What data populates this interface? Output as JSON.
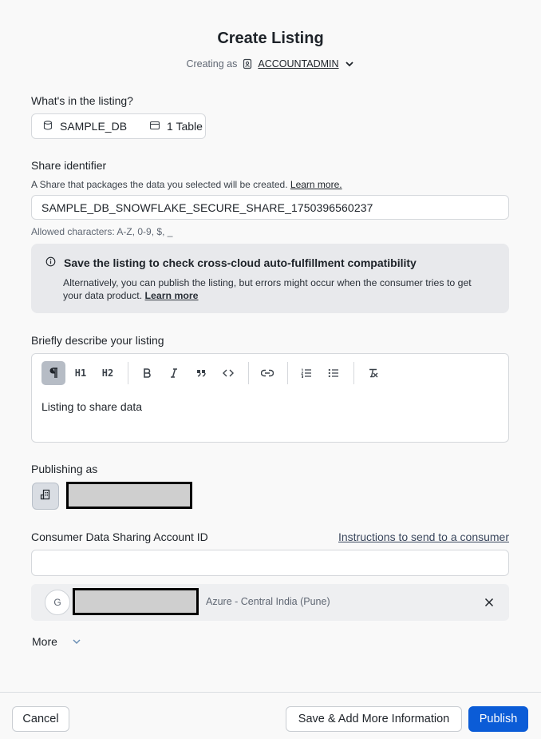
{
  "header": {
    "title": "Create Listing",
    "creating_as_label": "Creating as",
    "role": "ACCOUNTADMIN"
  },
  "contents": {
    "label": "What's in the listing?",
    "database": "SAMPLE_DB",
    "tables": "1 Table"
  },
  "share": {
    "label": "Share identifier",
    "description": "A Share that packages the data you selected will be created.",
    "learn_more": "Learn more.",
    "value": "SAMPLE_DB_SNOWFLAKE_SECURE_SHARE_1750396560237",
    "hint": "Allowed characters: A-Z, 0-9, $, _"
  },
  "notice": {
    "title": "Save the listing to check cross-cloud auto-fulfillment compatibility",
    "body": "Alternatively, you can publish the listing, but errors might occur when the consumer tries to get your data product.",
    "learn_more": "Learn more"
  },
  "description": {
    "label": "Briefly describe your listing",
    "text": "Listing to share data",
    "toolbar": {
      "h1": "H1",
      "h2": "H2"
    }
  },
  "publishing": {
    "label": "Publishing as"
  },
  "consumer": {
    "label": "Consumer Data Sharing Account ID",
    "instructions_link": "Instructions to send to a consumer",
    "input_value": "",
    "entry_initial": "G",
    "entry_region": "Azure - Central India (Pune)"
  },
  "more": {
    "label": "More"
  },
  "footer": {
    "cancel": "Cancel",
    "save_more": "Save & Add More Information",
    "publish": "Publish"
  },
  "colors": {
    "primary": "#0b5cd7",
    "notice_bg": "#e8e9ec",
    "page_bg": "#f9f9f9"
  }
}
